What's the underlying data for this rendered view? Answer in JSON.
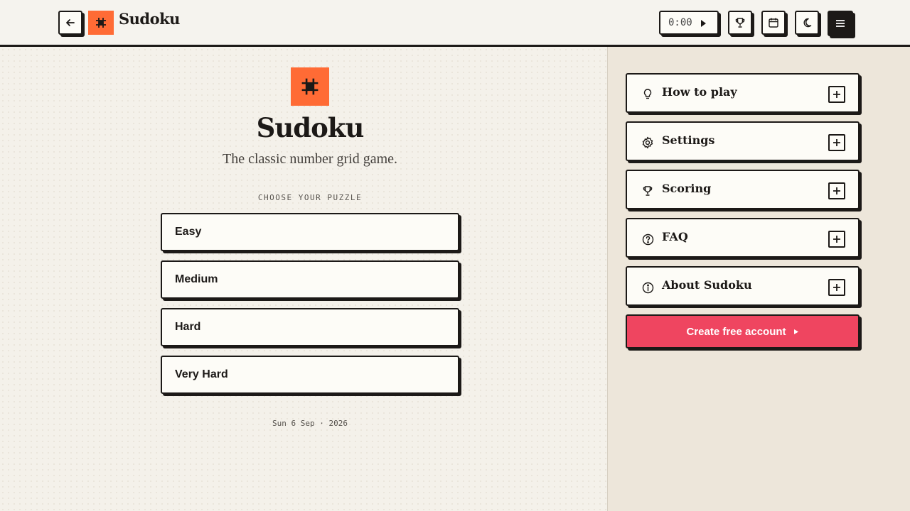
{
  "header": {
    "brand": "Sudoku",
    "timer": "0:00",
    "icons": {
      "back": "arrow-left-icon",
      "logo": "hash-icon",
      "play": "play-icon",
      "trophy": "trophy-icon",
      "calendar": "calendar-icon",
      "theme": "moon-icon",
      "menu": "hamburger-menu-icon"
    }
  },
  "main": {
    "title": "Sudoku",
    "subtitle": "The classic number grid game.",
    "choose_label": "CHOOSE YOUR PUZZLE",
    "difficulties": [
      "Easy",
      "Medium",
      "Hard",
      "Very Hard"
    ],
    "date": "Sun 6 Sep · 2026"
  },
  "sidebar": {
    "items": [
      {
        "label": "How to play",
        "icon": "lightbulb-icon"
      },
      {
        "label": "Settings",
        "icon": "gear-icon"
      },
      {
        "label": "Scoring",
        "icon": "trophy-icon"
      },
      {
        "label": "FAQ",
        "icon": "question-circle-icon"
      },
      {
        "label": "About Sudoku",
        "icon": "info-circle-icon"
      }
    ],
    "cta_label": "Create free account"
  },
  "colors": {
    "accent_orange": "#ff6b35",
    "cta_red": "#ef4560",
    "ink": "#1c1917",
    "background": "#f3f0e8"
  }
}
